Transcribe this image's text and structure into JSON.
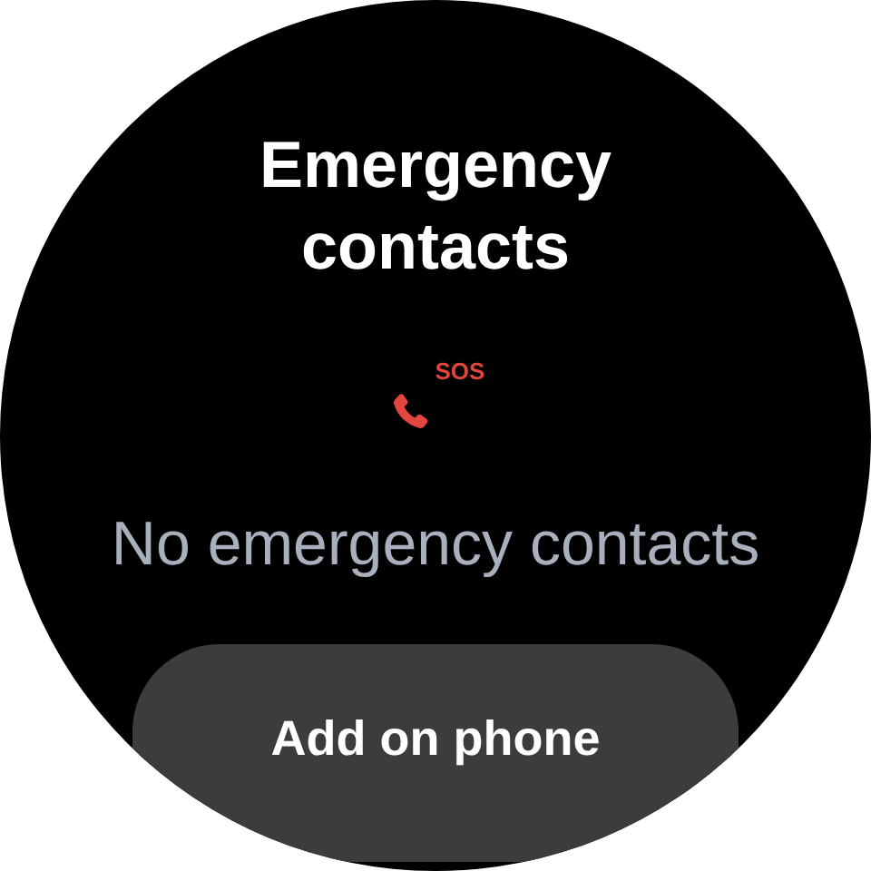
{
  "title": "Emergency contacts",
  "icon_badge": "SOS",
  "message": "No emergency contacts",
  "button": {
    "label": "Add on phone"
  }
}
